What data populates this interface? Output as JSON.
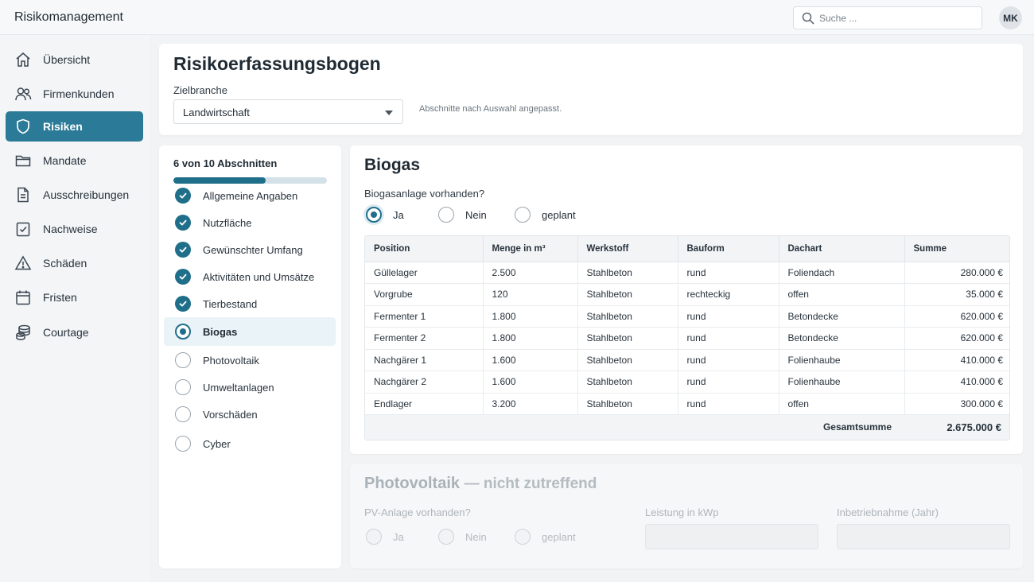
{
  "app": {
    "title": "Risikomanagement"
  },
  "search": {
    "placeholder": "Suche ..."
  },
  "user": {
    "initials": "MK"
  },
  "colors": {
    "accent": "#2b7a97",
    "progress": "#1f6f8b"
  },
  "sidebar": {
    "items": [
      {
        "label": "Übersicht",
        "icon": "home-icon"
      },
      {
        "label": "Firmenkunden",
        "icon": "users-icon"
      },
      {
        "label": "Risiken",
        "icon": "shield-icon",
        "active": true
      },
      {
        "label": "Mandate",
        "icon": "folder-icon"
      },
      {
        "label": "Ausschreibungen",
        "icon": "document-icon"
      },
      {
        "label": "Nachweise",
        "icon": "checklist-icon"
      },
      {
        "label": "Schäden",
        "icon": "warning-icon"
      },
      {
        "label": "Fristen",
        "icon": "calendar-icon"
      },
      {
        "label": "Courtage",
        "icon": "coins-icon"
      }
    ]
  },
  "form": {
    "title": "Risikoerfassungsbogen",
    "branch_label": "Zielbranche",
    "branch_value": "Landwirtschaft",
    "hint": "Abschnitte nach Auswahl angepasst."
  },
  "progress": {
    "label": "6 von 10 Abschnitten",
    "completed": 6,
    "total": 10
  },
  "steps": [
    {
      "label": "Allgemeine Angaben",
      "status": "done"
    },
    {
      "label": "Nutzfläche",
      "status": "done"
    },
    {
      "label": "Gewünschter Umfang",
      "status": "done"
    },
    {
      "label": "Aktivitäten und Umsätze",
      "status": "done"
    },
    {
      "label": "Tierbestand",
      "status": "done"
    },
    {
      "label": "Biogas",
      "status": "current"
    },
    {
      "label": "Photovoltaik",
      "status": "todo"
    },
    {
      "label": "Umweltanlagen",
      "status": "todo"
    },
    {
      "label": "Vorschäden",
      "status": "todo"
    },
    {
      "label": "Cyber",
      "status": "todo"
    }
  ],
  "biogas": {
    "title": "Biogas",
    "question": "Biogasanlage vorhanden?",
    "options": [
      "Ja",
      "Nein",
      "geplant"
    ],
    "selected": "Ja",
    "table": {
      "headers": [
        "Position",
        "Menge in m³",
        "Werkstoff",
        "Bauform",
        "Dachart",
        "Summe"
      ],
      "rows": [
        [
          "Güllelager",
          "2.500",
          "Stahlbeton",
          "rund",
          "Foliendach",
          "280.000 €"
        ],
        [
          "Vorgrube",
          "120",
          "Stahlbeton",
          "rechteckig",
          "offen",
          "35.000 €"
        ],
        [
          "Fermenter 1",
          "1.800",
          "Stahlbeton",
          "rund",
          "Betondecke",
          "620.000 €"
        ],
        [
          "Fermenter 2",
          "1.800",
          "Stahlbeton",
          "rund",
          "Betondecke",
          "620.000 €"
        ],
        [
          "Nachgärer 1",
          "1.600",
          "Stahlbeton",
          "rund",
          "Folienhaube",
          "410.000 €"
        ],
        [
          "Nachgärer 2",
          "1.600",
          "Stahlbeton",
          "rund",
          "Folienhaube",
          "410.000 €"
        ],
        [
          "Endlager",
          "3.200",
          "Stahlbeton",
          "rund",
          "offen",
          "300.000 €"
        ]
      ],
      "total_label": "Gesamtsumme",
      "total_value": "2.675.000 €"
    }
  },
  "photovoltaik": {
    "title": "Photovoltaik",
    "subtitle": "— nicht zutreffend",
    "question": "PV-Anlage vorhanden?",
    "options": [
      "Ja",
      "Nein",
      "geplant"
    ],
    "power_label": "Leistung in kWp",
    "year_label": "Inbetriebnahme (Jahr)"
  }
}
